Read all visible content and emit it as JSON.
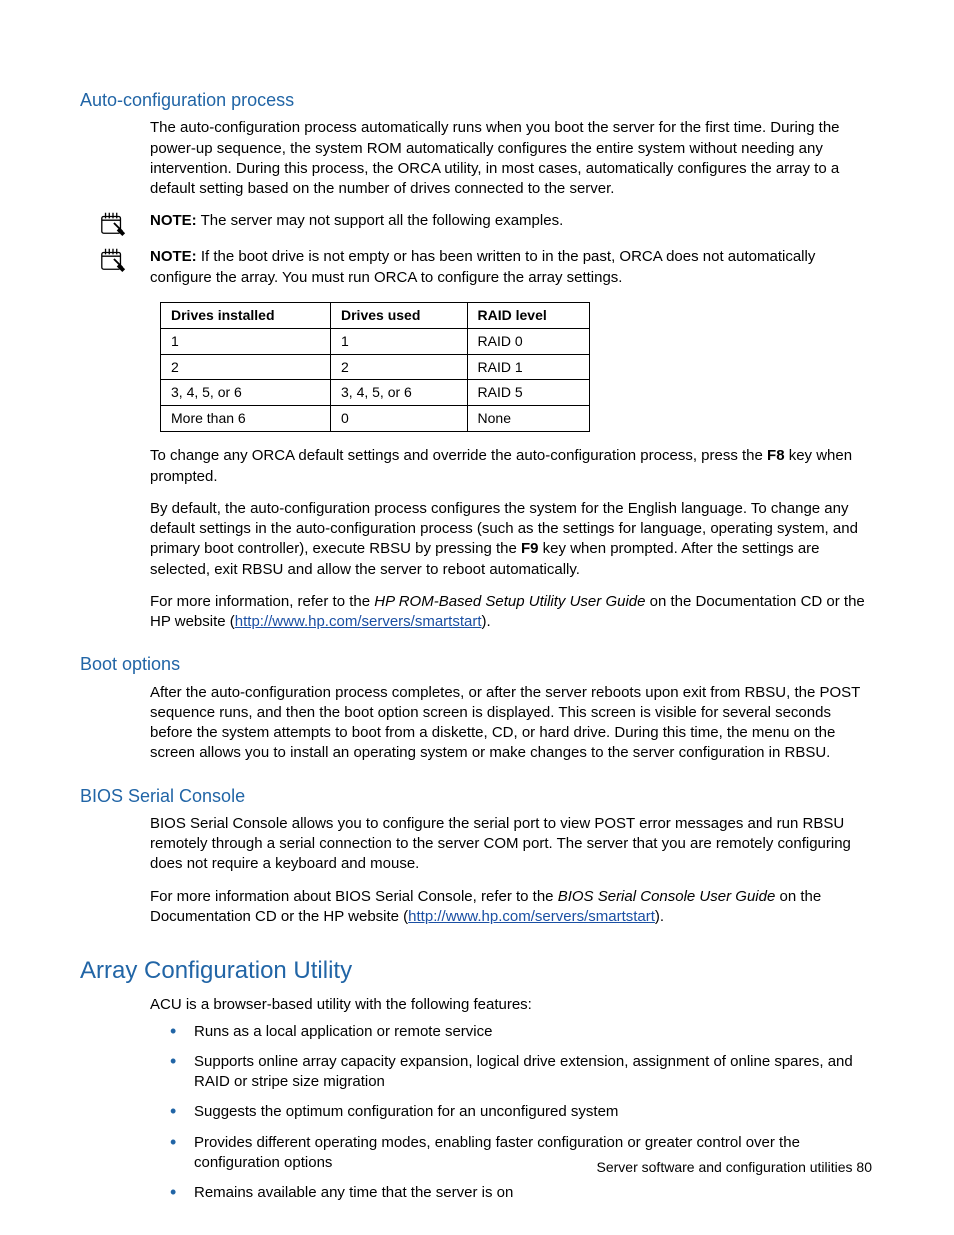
{
  "sections": {
    "autoconfig": {
      "title": "Auto-configuration process",
      "p1": "The auto-configuration process automatically runs when you boot the server for the first time. During the power-up sequence, the system ROM automatically configures the entire system without needing any intervention. During this process, the ORCA utility, in most cases, automatically configures the array to a default setting based on the number of drives connected to the server.",
      "note1_label": "NOTE:",
      "note1_text": "  The server may not support all the following examples.",
      "note2_label": "NOTE:",
      "note2_text": "  If the boot drive is not empty or has been written to in the past, ORCA does not automatically configure the array. You must run ORCA to configure the array settings.",
      "table": {
        "headers": [
          "Drives installed",
          "Drives used",
          "RAID level"
        ],
        "rows": [
          [
            "1",
            "1",
            "RAID 0"
          ],
          [
            "2",
            "2",
            "RAID 1"
          ],
          [
            "3, 4, 5, or 6",
            "3, 4, 5, or 6",
            "RAID 5"
          ],
          [
            "More than 6",
            "0",
            "None"
          ]
        ]
      },
      "p2_a": "To change any ORCA default settings and override the auto-configuration process, press the ",
      "p2_b": "F8",
      "p2_c": " key when prompted.",
      "p3_a": "By default, the auto-configuration process configures the system for the English language. To change any default settings in the auto-configuration process (such as the settings for language, operating system, and primary boot controller), execute RBSU by pressing the ",
      "p3_b": "F9",
      "p3_c": " key when prompted. After the settings are selected, exit RBSU and allow the server to reboot automatically.",
      "p4_a": "For more information, refer to the ",
      "p4_b": "HP ROM-Based Setup Utility User Guide",
      "p4_c": " on the Documentation CD or the HP website (",
      "p4_link": "http://www.hp.com/servers/smartstart",
      "p4_d": ")."
    },
    "boot": {
      "title": "Boot options",
      "p1": "After the auto-configuration process completes, or after the server reboots upon exit from RBSU, the POST sequence runs, and then the boot option screen is displayed. This screen is visible for several seconds before the system attempts to boot from a diskette, CD, or hard drive. During this time, the menu on the screen allows you to install an operating system or make changes to the server configuration in RBSU."
    },
    "bios": {
      "title": "BIOS Serial Console",
      "p1": "BIOS Serial Console allows you to configure the serial port to view POST error messages and run RBSU remotely through a serial connection to the server COM port. The server that you are remotely configuring does not require a keyboard and mouse.",
      "p2_a": "For more information about BIOS Serial Console, refer to the ",
      "p2_b": "BIOS Serial Console User Guide",
      "p2_c": " on the Documentation CD or the HP website (",
      "p2_link": "http://www.hp.com/servers/smartstart",
      "p2_d": ")."
    },
    "acu": {
      "title": "Array Configuration Utility",
      "p1": "ACU is a browser-based utility with the following features:",
      "bullets": [
        "Runs as a local application or remote service",
        "Supports online array capacity expansion, logical drive extension, assignment of online spares, and RAID or stripe size migration",
        "Suggests the optimum configuration for an unconfigured system",
        "Provides different operating modes, enabling faster configuration or greater control over the configuration options",
        "Remains available any time that the server is on"
      ]
    }
  },
  "footer": {
    "text": "Server software and configuration utilities   80"
  }
}
